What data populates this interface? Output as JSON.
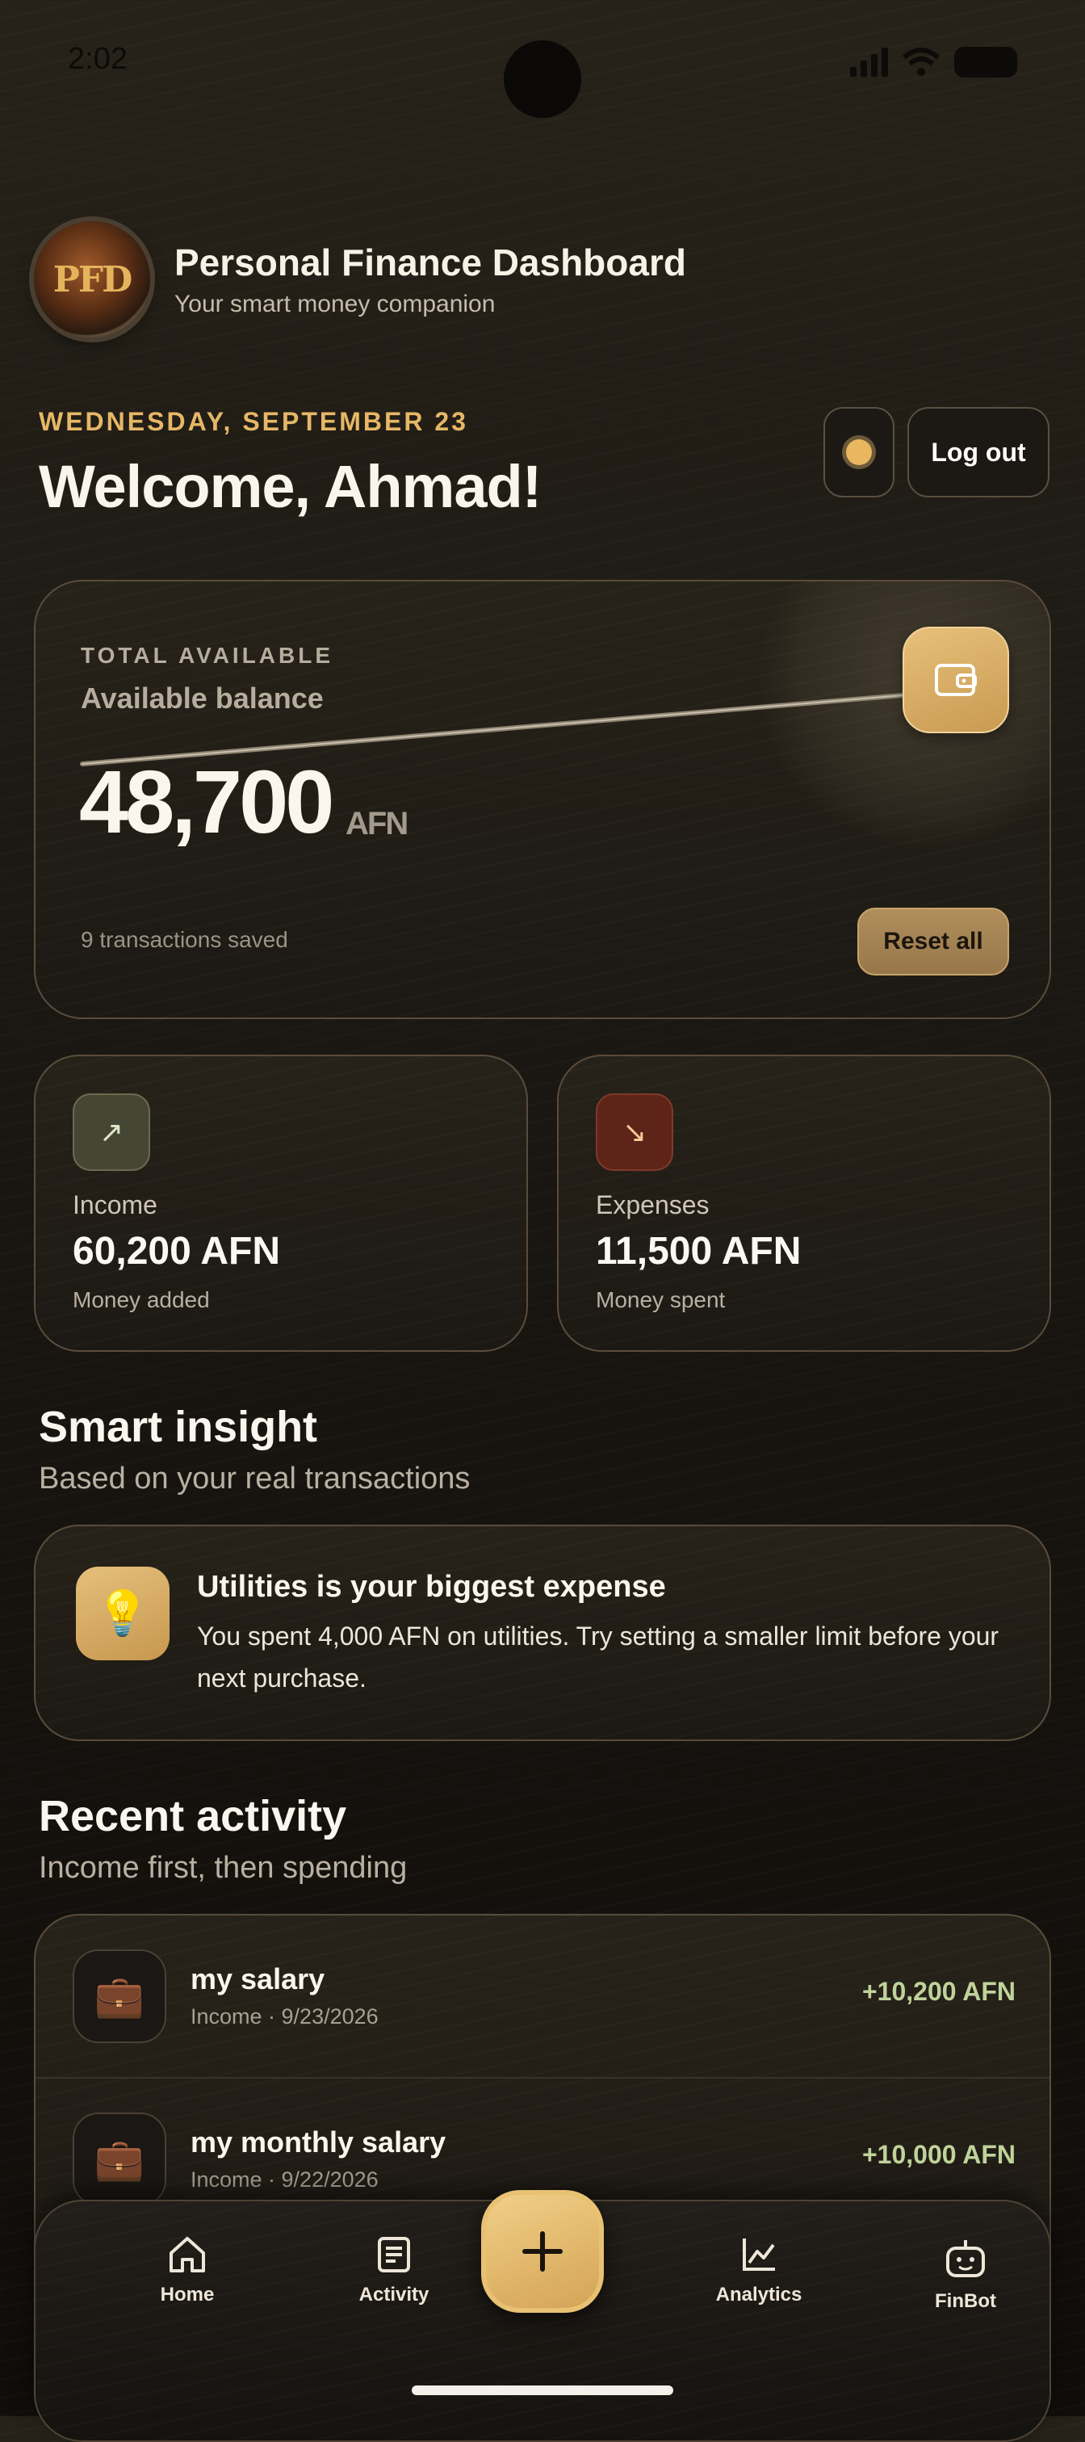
{
  "status_bar": {
    "time": "2:02"
  },
  "header": {
    "logo_text": "PFD",
    "title": "Personal Finance Dashboard",
    "subtitle": "Your smart money companion"
  },
  "greeting": {
    "date": "WEDNESDAY, SEPTEMBER 23",
    "welcome": "Welcome, Ahmad!",
    "logout_label": "Log out"
  },
  "balance": {
    "label": "TOTAL AVAILABLE",
    "sublabel": "Available balance",
    "amount": "48,700",
    "currency": "AFN",
    "transactions_saved": "9 transactions saved",
    "reset_label": "Reset all"
  },
  "stats": {
    "income": {
      "label": "Income",
      "value": "60,200 AFN",
      "note": "Money added",
      "icon": "↗"
    },
    "expenses": {
      "label": "Expenses",
      "value": "11,500 AFN",
      "note": "Money spent",
      "icon": "↘"
    }
  },
  "insight": {
    "section_title": "Smart insight",
    "section_subtitle": "Based on your real transactions",
    "title": "Utilities is your biggest expense",
    "text": "You spent 4,000 AFN on utilities. Try setting a smaller limit before your next purchase.",
    "icon": "💡"
  },
  "activity": {
    "section_title": "Recent activity",
    "section_subtitle": "Income first, then spending",
    "items": [
      {
        "title": "my salary",
        "meta": "Income · 9/23/2026",
        "amount": "+10,200 AFN",
        "icon": "💼"
      },
      {
        "title": "my monthly salary",
        "meta": "Income · 9/22/2026",
        "amount": "+10,000 AFN",
        "icon": "💼"
      }
    ]
  },
  "nav": {
    "items": [
      {
        "label": "Home",
        "icon": "home-icon"
      },
      {
        "label": "Activity",
        "icon": "activity-icon"
      },
      {
        "label": "Analytics",
        "icon": "analytics-icon"
      },
      {
        "label": "FinBot",
        "icon": "bot-icon"
      }
    ],
    "add_icon": "plus-icon"
  },
  "colors": {
    "accent_gold": "#e6b766",
    "income_green": "#bfd39a",
    "background": "#1c1914"
  }
}
